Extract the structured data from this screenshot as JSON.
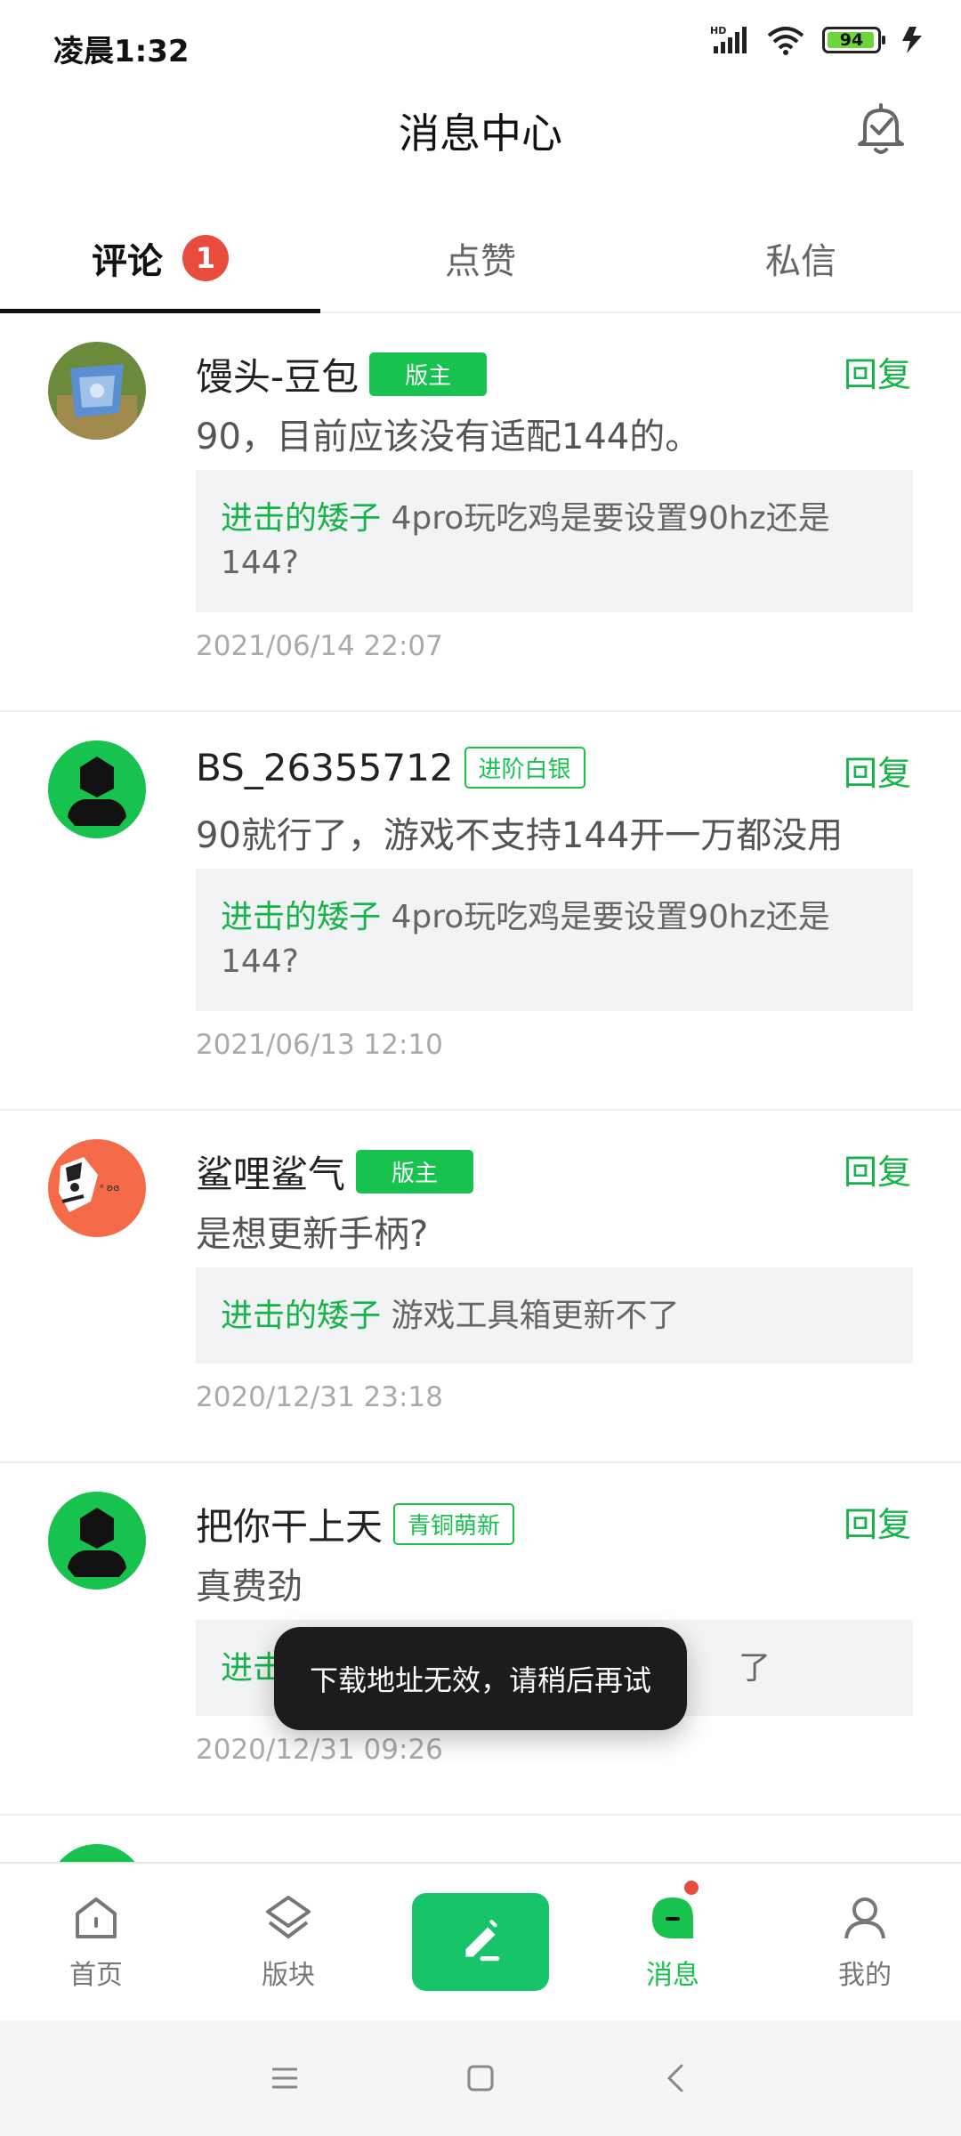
{
  "status_bar": {
    "time": "凌晨1:32",
    "network": "HD",
    "battery": "94"
  },
  "header": {
    "title": "消息中心"
  },
  "tabs": [
    {
      "label": "评论",
      "badge": "1"
    },
    {
      "label": "点赞"
    },
    {
      "label": "私信"
    }
  ],
  "comments": [
    {
      "name": "馒头-豆包",
      "badge": "版主",
      "badge_style": "mod",
      "reply": "回复",
      "text": "90，目前应该没有适配144的。",
      "quote_user": "进击的矮子",
      "quote_text": " 4pro玩吃鸡是要设置90hz还是144?",
      "time": "2021/06/14 22:07"
    },
    {
      "name": "BS_26355712",
      "badge": "进阶白银",
      "badge_style": "outline",
      "reply": "回复",
      "text": "90就行了，游戏不支持144开一万都没用",
      "quote_user": "进击的矮子",
      "quote_text": " 4pro玩吃鸡是要设置90hz还是144?",
      "time": "2021/06/13 12:10"
    },
    {
      "name": "鲨哩鲨气",
      "badge": "版主",
      "badge_style": "mod",
      "reply": "回复",
      "text": "是想更新手柄?",
      "quote_user": "进击的矮子",
      "quote_text": " 游戏工具箱更新不了",
      "time": "2020/12/31 23:18"
    },
    {
      "name": "把你干上天",
      "badge": "青铜萌新",
      "badge_style": "outline",
      "reply": "回复",
      "text": "真费劲",
      "quote_user": "进击",
      "quote_text": "了",
      "time": "2020/12/31 09:26"
    }
  ],
  "toast": "下载地址无效，请稍后再试",
  "bottom_nav": [
    {
      "label": "首页",
      "icon": "home-icon"
    },
    {
      "label": "版块",
      "icon": "layers-icon"
    },
    {
      "label": "",
      "icon": "compose-icon"
    },
    {
      "label": "消息",
      "icon": "message-icon",
      "active": true
    },
    {
      "label": "我的",
      "icon": "user-icon"
    }
  ],
  "colors": {
    "accent": "#17c24e",
    "badge_red": "#e74c3c",
    "toast_bg": "#1c1c1c"
  }
}
